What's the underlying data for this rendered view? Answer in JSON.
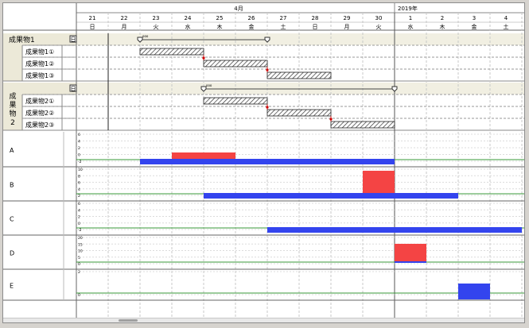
{
  "header": {
    "month_label": "4月",
    "year_label": "2019年",
    "days": [
      {
        "date": "21",
        "dow": "日"
      },
      {
        "date": "22",
        "dow": "月"
      },
      {
        "date": "23",
        "dow": "火"
      },
      {
        "date": "24",
        "dow": "水"
      },
      {
        "date": "25",
        "dow": "木"
      },
      {
        "date": "26",
        "dow": "金"
      },
      {
        "date": "27",
        "dow": "土"
      },
      {
        "date": "28",
        "dow": "日"
      },
      {
        "date": "29",
        "dow": "月"
      },
      {
        "date": "30",
        "dow": "火"
      },
      {
        "date": "1",
        "dow": "水"
      },
      {
        "date": "2",
        "dow": "木"
      },
      {
        "date": "3",
        "dow": "金"
      },
      {
        "date": "4",
        "dow": "土"
      }
    ]
  },
  "groups": [
    {
      "label": "成果物1",
      "collapse_glyph": "日",
      "summary_note": "ooo",
      "summary_span": [
        2,
        6
      ],
      "tasks": [
        {
          "label": "成果物1①",
          "span": [
            2,
            3
          ]
        },
        {
          "label": "成果物1②",
          "span": [
            4,
            5
          ]
        },
        {
          "label": "成果物1③",
          "span": [
            6,
            7
          ]
        }
      ]
    },
    {
      "label": "成果物2",
      "collapse_glyph": "日",
      "summary_note": "ooo",
      "summary_span": [
        4,
        10
      ],
      "tasks": [
        {
          "label": "成果物2①",
          "span": [
            4,
            5
          ]
        },
        {
          "label": "成果物2②",
          "span": [
            6,
            7
          ]
        },
        {
          "label": "成果物2③",
          "span": [
            8,
            9
          ]
        }
      ]
    }
  ],
  "resources": [
    {
      "label": "A",
      "ticks": [
        "6",
        "4",
        "2",
        "0",
        "-2"
      ],
      "blue": [
        2,
        9
      ],
      "red": [
        3,
        4
      ]
    },
    {
      "label": "B",
      "ticks": [
        "10",
        "8",
        "6",
        "4",
        "2"
      ],
      "blue": [
        4,
        11
      ],
      "red": [
        9,
        9
      ]
    },
    {
      "label": "C",
      "ticks": [
        "6",
        "4",
        "2",
        "0",
        "-2"
      ],
      "blue": [
        6,
        13
      ],
      "red": null
    },
    {
      "label": "D",
      "ticks": [
        "20",
        "15",
        "10",
        "5",
        "0"
      ],
      "blue": [
        10,
        10
      ],
      "red": [
        10,
        10
      ]
    },
    {
      "label": "E",
      "ticks": [
        "2",
        "0"
      ],
      "blue": [
        12,
        12
      ],
      "red": null
    }
  ],
  "colors": {
    "header_bg": "#ffffff",
    "label_bg": "#ece9d8",
    "summary_row_bg": "#f1efe2",
    "grid": "#c8c8c8",
    "resource_blue": "#3344ee",
    "resource_red": "#f44444",
    "capacity_line": "#3a9a3a",
    "milestone_red": "#cc0000"
  }
}
